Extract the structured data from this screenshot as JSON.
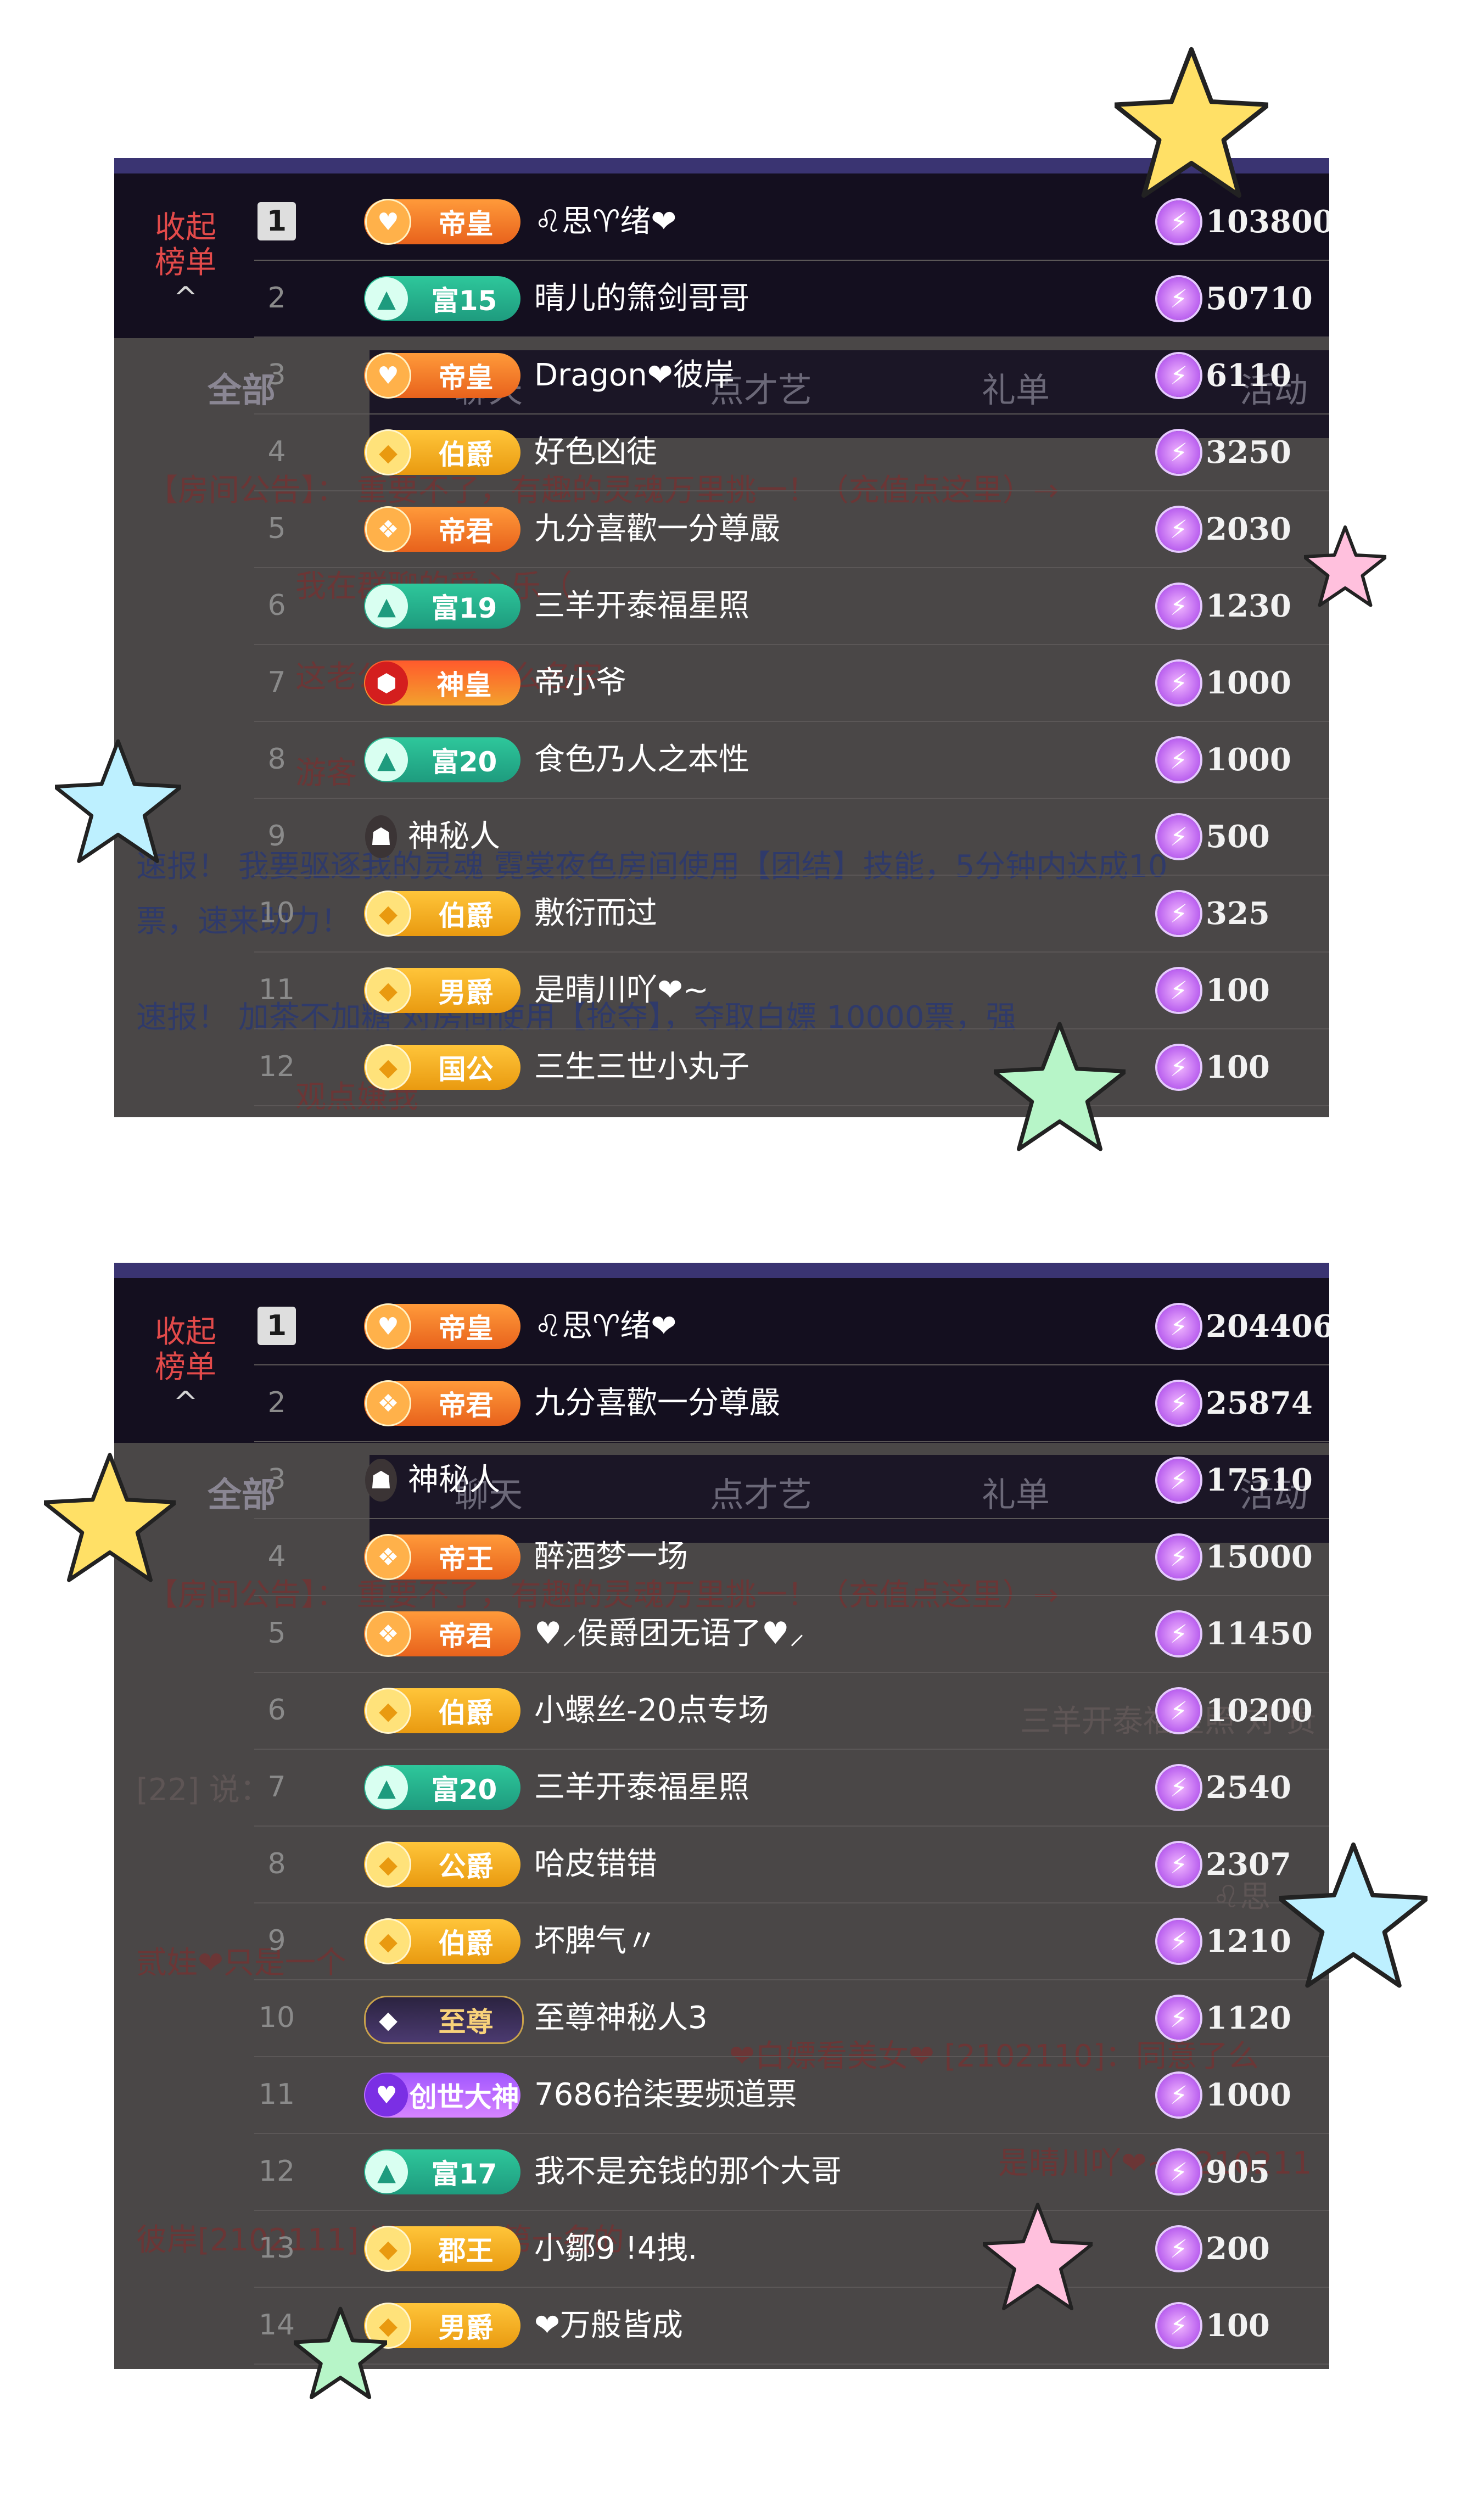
{
  "collapse_label": {
    "line1": "收起",
    "line2": "榜单",
    "caret": "^"
  },
  "tabs": {
    "all": "全部",
    "chat": "聊天",
    "talent": "点才艺",
    "gift": "礼单",
    "activity": "活动"
  },
  "panel1": {
    "bg_lines": [
      {
        "text": "【房间公告】：  重要不了，有趣的灵魂万里挑一！（充值点这里）→",
        "cls": "red"
      },
      {
        "text": "我在群聊的爱心乐（",
        "cls": "red"
      },
      {
        "text": "这老公我要用什么名字",
        "cls": "red"
      },
      {
        "text": "游客",
        "cls": "red"
      },
      {
        "text": "速报！ 我要驱逐我的灵魂 霓裳夜色房间使用【团结】技能，5分钟内达成10",
        "cls": "blue"
      },
      {
        "text": "票，速来助力！",
        "cls": "blue"
      },
      {
        "text": "速报！ 加茶不加糖 对房间使用【抢夺】，夺取白嫖 10000票，强",
        "cls": "blue"
      },
      {
        "text": "观点嫌我",
        "cls": "red"
      }
    ],
    "rows": [
      {
        "rank": "1",
        "badge": "帝皇",
        "style": "orange",
        "icon": "♥",
        "name": "♌思♈绪❤",
        "score": "103800"
      },
      {
        "rank": "2",
        "badge": "富15",
        "style": "green",
        "icon": "▲",
        "name": "晴儿的箫剑哥哥",
        "score": "50710"
      },
      {
        "rank": "3",
        "badge": "帝皇",
        "style": "orange",
        "icon": "♥",
        "name": "Dragon❤彼岸",
        "score": "6110"
      },
      {
        "rank": "4",
        "badge": "伯爵",
        "style": "gold",
        "icon": "◆",
        "name": "好色凶徒",
        "score": "3250"
      },
      {
        "rank": "5",
        "badge": "帝君",
        "style": "orange",
        "icon": "❖",
        "name": "九分喜歡一分尊嚴",
        "score": "2030"
      },
      {
        "rank": "6",
        "badge": "富19",
        "style": "green",
        "icon": "▲",
        "name": "三羊开泰福星照",
        "score": "1230"
      },
      {
        "rank": "7",
        "badge": "神皇",
        "style": "red",
        "icon": "⬢",
        "name": "帝小爷",
        "score": "1000"
      },
      {
        "rank": "8",
        "badge": "富20",
        "style": "green",
        "icon": "▲",
        "name": "食色乃人之本性",
        "score": "1000"
      },
      {
        "rank": "9",
        "badge": "",
        "style": "none",
        "icon": "☗",
        "name": "神秘人",
        "score": "500"
      },
      {
        "rank": "10",
        "badge": "伯爵",
        "style": "gold",
        "icon": "◆",
        "name": "敷衍而过",
        "score": "325"
      },
      {
        "rank": "11",
        "badge": "男爵",
        "style": "gold",
        "icon": "◆",
        "name": "是晴川吖❤~",
        "score": "100"
      },
      {
        "rank": "12",
        "badge": "国公",
        "style": "gold",
        "icon": "◆",
        "name": "三生三世小丸子",
        "score": "100"
      }
    ]
  },
  "panel2": {
    "bg_lines": [
      {
        "text": "【房间公告】：  重要不了，有趣的灵魂万里挑一！（充值点这里）→",
        "cls": "red"
      },
      {
        "text": "三羊开泰福星照 对 贵",
        "cls": ""
      },
      {
        "text": "[22] 说：",
        "cls": ""
      },
      {
        "text": "♌思",
        "cls": ""
      },
      {
        "text": "贰娃❤只是一个",
        "cls": "red"
      },
      {
        "text": "❤白嫖看美女❤ [2102110]：同意了么",
        "cls": "red"
      },
      {
        "text": "是晴川吖❤~ [210211",
        "cls": "red"
      },
      {
        "text": "彼岸[2102111] 说：  都是第一名的",
        "cls": "red"
      }
    ],
    "rows": [
      {
        "rank": "1",
        "badge": "帝皇",
        "style": "orange",
        "icon": "♥",
        "name": "♌思♈绪❤",
        "score": "204406"
      },
      {
        "rank": "2",
        "badge": "帝君",
        "style": "orange",
        "icon": "❖",
        "name": "九分喜歡一分尊嚴",
        "score": "25874"
      },
      {
        "rank": "3",
        "badge": "",
        "style": "none",
        "icon": "☗",
        "name": "神秘人",
        "score": "17510"
      },
      {
        "rank": "4",
        "badge": "帝王",
        "style": "orange",
        "icon": "❖",
        "name": "醉酒梦一场",
        "score": "15000"
      },
      {
        "rank": "5",
        "badge": "帝君",
        "style": "orange",
        "icon": "❖",
        "name": "♥⸝侯爵团无语了♥⸝",
        "score": "11450"
      },
      {
        "rank": "6",
        "badge": "伯爵",
        "style": "gold",
        "icon": "◆",
        "name": "小螺丝-20点专场",
        "score": "10200"
      },
      {
        "rank": "7",
        "badge": "富20",
        "style": "green",
        "icon": "▲",
        "name": "三羊开泰福星照",
        "score": "2540"
      },
      {
        "rank": "8",
        "badge": "公爵",
        "style": "gold",
        "icon": "◆",
        "name": "哈皮错错",
        "score": "2307"
      },
      {
        "rank": "9",
        "badge": "伯爵",
        "style": "gold",
        "icon": "◆",
        "name": "坏脾气〃",
        "score": "1210"
      },
      {
        "rank": "10",
        "badge": "至尊",
        "style": "supreme",
        "icon": "◆",
        "name": "至尊神秘人3",
        "score": "1120"
      },
      {
        "rank": "11",
        "badge": "创世大神",
        "style": "purple",
        "icon": "♥",
        "name": "7686拾柒要频道票",
        "score": "1000"
      },
      {
        "rank": "12",
        "badge": "富17",
        "style": "green",
        "icon": "▲",
        "name": "我不是充钱的那个大哥",
        "score": "905"
      },
      {
        "rank": "13",
        "badge": "郡王",
        "style": "gold",
        "icon": "◆",
        "name": "小鄒9 !4拽.",
        "score": "200"
      },
      {
        "rank": "14",
        "badge": "男爵",
        "style": "gold",
        "icon": "◆",
        "name": "❤万般皆成",
        "score": "100"
      }
    ]
  },
  "score_icon": "bolt-icon",
  "colors": {
    "panel_bg": "#4a4747",
    "header_dark": "#140f1f",
    "accent_purple": "#3a3472",
    "collapse_red": "#e24a4a"
  }
}
